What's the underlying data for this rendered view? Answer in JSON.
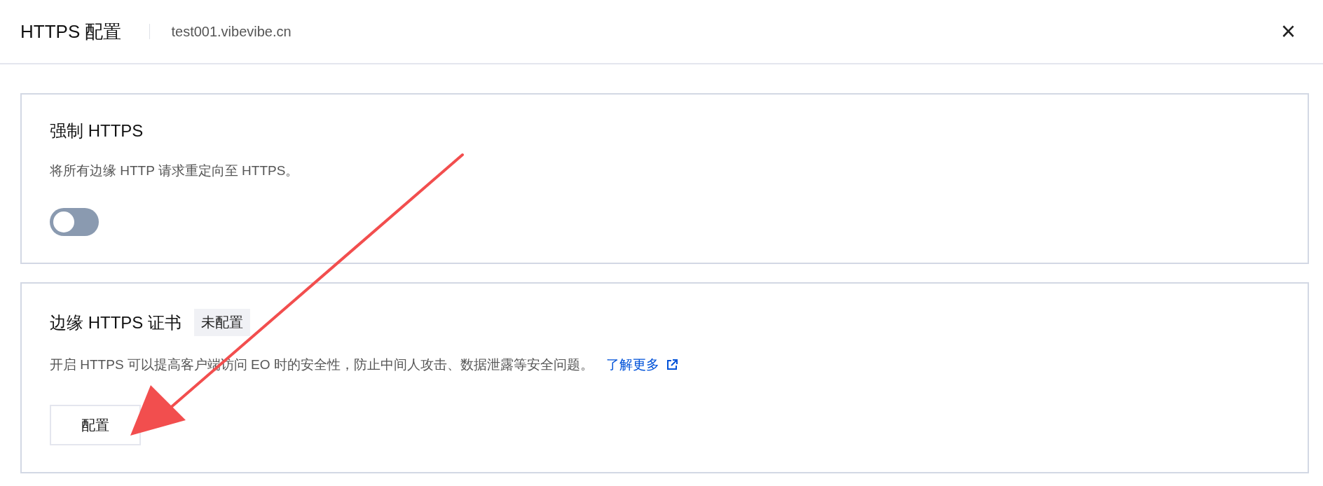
{
  "dialog": {
    "title": "HTTPS 配置",
    "domain": "test001.vibevibe.cn",
    "close": "×"
  },
  "sections": [
    {
      "kind": "toggle",
      "title": "强制 HTTPS",
      "description": "将所有边缘 HTTP 请求重定向至 HTTPS。",
      "on": false
    },
    {
      "kind": "certificate",
      "title": "边缘 HTTPS 证书",
      "badge": "未配置",
      "description": "开启 HTTPS 可以提高客户端访问 EO 时的安全性，防止中间人攻击、数据泄露等安全问题。",
      "link": "了解更多",
      "button": "配置"
    }
  ]
}
